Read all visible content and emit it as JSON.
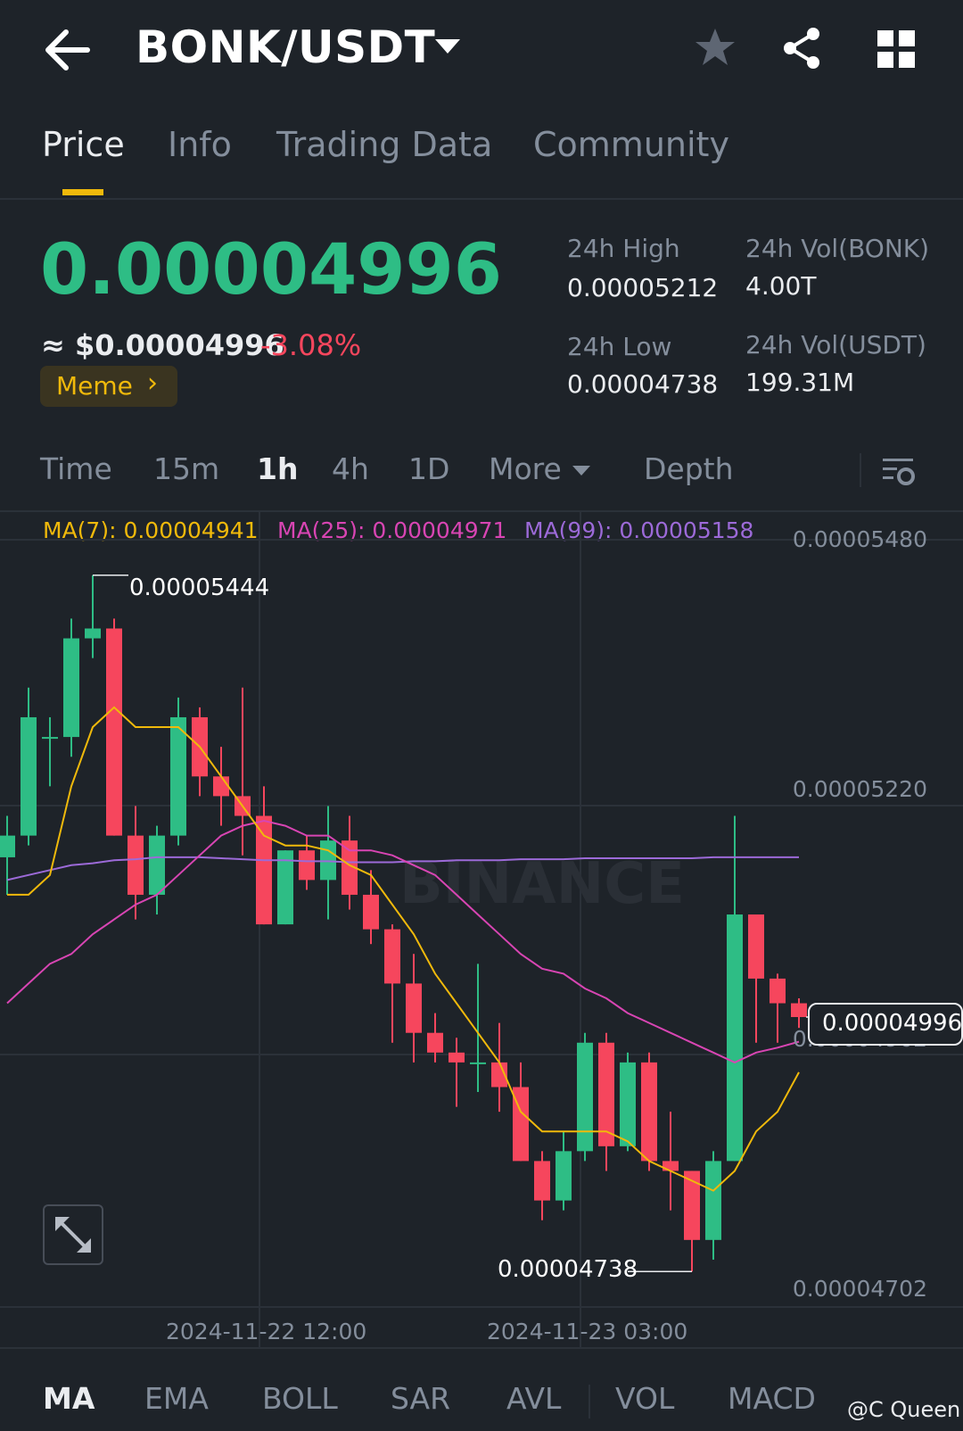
{
  "header": {
    "pair": "BONK/USDT",
    "icons": [
      "back-arrow-icon",
      "caret-down-icon",
      "star-icon",
      "share-icon",
      "grid-icon"
    ]
  },
  "tabs": [
    {
      "label": "Price",
      "active": true
    },
    {
      "label": "Info"
    },
    {
      "label": "Trading Data"
    },
    {
      "label": "Community"
    }
  ],
  "price": {
    "last": "0.00004996",
    "usd": "≈ $0.00004996",
    "change": "-3.08%",
    "tag": "Meme",
    "colors": {
      "up": "#2ebd85",
      "down": "#f6465d",
      "accent": "#f0b90b"
    }
  },
  "stats": {
    "high_label": "24h High",
    "high": "0.00005212",
    "low_label": "24h Low",
    "low": "0.00004738",
    "vol_base_label": "24h Vol(BONK)",
    "vol_base": "4.00T",
    "vol_quote_label": "24h Vol(USDT)",
    "vol_quote": "199.31M"
  },
  "intervals": {
    "time": "Time",
    "m15": "15m",
    "h1": "1h",
    "h4": "4h",
    "d1": "1D",
    "more": "More",
    "depth": "Depth",
    "active": "1h"
  },
  "ma_legend": {
    "ma7": "MA(7): 0.00004941",
    "ma25": "MA(25): 0.00004971",
    "ma99": "MA(99): 0.00005158"
  },
  "chart_data": {
    "type": "candlestick",
    "interval": "1h",
    "ylim": [
      4.702e-05,
      5.48e-05
    ],
    "y_ticks": [
      "0.00005480",
      "0.00005220",
      "0.00004962",
      "0.00004702"
    ],
    "x_ticks": [
      "2024-11-22 12:00",
      "2024-11-23 03:00"
    ],
    "high_annotation": "0.00005444",
    "low_annotation": "0.00004738",
    "last_price_label": "0.00004996",
    "watermark": "BINANCE",
    "candles": [
      {
        "o": 5.158e-05,
        "h": 5.2e-05,
        "l": 5.12e-05,
        "c": 5.18e-05
      },
      {
        "o": 5.18e-05,
        "h": 5.33e-05,
        "l": 5.17e-05,
        "c": 5.3e-05
      },
      {
        "o": 5.28e-05,
        "h": 5.3e-05,
        "l": 5.23e-05,
        "c": 5.28e-05
      },
      {
        "o": 5.28e-05,
        "h": 5.4e-05,
        "l": 5.26e-05,
        "c": 5.38e-05
      },
      {
        "o": 5.38e-05,
        "h": 5.444e-05,
        "l": 5.36e-05,
        "c": 5.39e-05
      },
      {
        "o": 5.39e-05,
        "h": 5.4e-05,
        "l": 5.18e-05,
        "c": 5.18e-05
      },
      {
        "o": 5.18e-05,
        "h": 5.21e-05,
        "l": 5.095e-05,
        "c": 5.12e-05
      },
      {
        "o": 5.12e-05,
        "h": 5.19e-05,
        "l": 5.1e-05,
        "c": 5.18e-05
      },
      {
        "o": 5.18e-05,
        "h": 5.32e-05,
        "l": 5.17e-05,
        "c": 5.3e-05
      },
      {
        "o": 5.3e-05,
        "h": 5.31e-05,
        "l": 5.22e-05,
        "c": 5.24e-05
      },
      {
        "o": 5.24e-05,
        "h": 5.27e-05,
        "l": 5.19e-05,
        "c": 5.22e-05
      },
      {
        "o": 5.22e-05,
        "h": 5.33e-05,
        "l": 5.16e-05,
        "c": 5.2e-05
      },
      {
        "o": 5.2e-05,
        "h": 5.23e-05,
        "l": 5.09e-05,
        "c": 5.09e-05
      },
      {
        "o": 5.09e-05,
        "h": 5.165e-05,
        "l": 5.09e-05,
        "c": 5.165e-05
      },
      {
        "o": 5.165e-05,
        "h": 5.18e-05,
        "l": 5.125e-05,
        "c": 5.135e-05
      },
      {
        "o": 5.135e-05,
        "h": 5.21e-05,
        "l": 5.095e-05,
        "c": 5.175e-05
      },
      {
        "o": 5.175e-05,
        "h": 5.2e-05,
        "l": 5.105e-05,
        "c": 5.12e-05
      },
      {
        "o": 5.12e-05,
        "h": 5.145e-05,
        "l": 5.07e-05,
        "c": 5.085e-05
      },
      {
        "o": 5.085e-05,
        "h": 5.09e-05,
        "l": 4.97e-05,
        "c": 5.03e-05
      },
      {
        "o": 5.03e-05,
        "h": 5.06e-05,
        "l": 4.95e-05,
        "c": 4.98e-05
      },
      {
        "o": 4.98e-05,
        "h": 5e-05,
        "l": 4.95e-05,
        "c": 4.96e-05
      },
      {
        "o": 4.96e-05,
        "h": 4.975e-05,
        "l": 4.905e-05,
        "c": 4.95e-05
      },
      {
        "o": 4.95e-05,
        "h": 5.05e-05,
        "l": 4.92e-05,
        "c": 4.95e-05
      },
      {
        "o": 4.95e-05,
        "h": 4.99e-05,
        "l": 4.9e-05,
        "c": 4.925e-05
      },
      {
        "o": 4.925e-05,
        "h": 4.95e-05,
        "l": 4.85e-05,
        "c": 4.85e-05
      },
      {
        "o": 4.85e-05,
        "h": 4.86e-05,
        "l": 4.79e-05,
        "c": 4.81e-05
      },
      {
        "o": 4.81e-05,
        "h": 4.88e-05,
        "l": 4.8e-05,
        "c": 4.86e-05
      },
      {
        "o": 4.86e-05,
        "h": 4.98e-05,
        "l": 4.85e-05,
        "c": 4.97e-05
      },
      {
        "o": 4.97e-05,
        "h": 4.98e-05,
        "l": 4.84e-05,
        "c": 4.865e-05
      },
      {
        "o": 4.865e-05,
        "h": 4.96e-05,
        "l": 4.86e-05,
        "c": 4.95e-05
      },
      {
        "o": 4.95e-05,
        "h": 4.96e-05,
        "l": 4.84e-05,
        "c": 4.85e-05
      },
      {
        "o": 4.85e-05,
        "h": 4.9e-05,
        "l": 4.8e-05,
        "c": 4.84e-05
      },
      {
        "o": 4.84e-05,
        "h": 4.84e-05,
        "l": 4.738e-05,
        "c": 4.77e-05
      },
      {
        "o": 4.77e-05,
        "h": 4.86e-05,
        "l": 4.75e-05,
        "c": 4.85e-05
      },
      {
        "o": 4.85e-05,
        "h": 5.2e-05,
        "l": 4.85e-05,
        "c": 5.1e-05
      },
      {
        "o": 5.1e-05,
        "h": 5.08e-05,
        "l": 4.97e-05,
        "c": 5.035e-05
      },
      {
        "o": 5.035e-05,
        "h": 5.04e-05,
        "l": 4.97e-05,
        "c": 5.01e-05
      },
      {
        "o": 5.01e-05,
        "h": 5.015e-05,
        "l": 4.985e-05,
        "c": 4.996e-05
      }
    ],
    "ma7": [
      5.12e-05,
      5.12e-05,
      5.14e-05,
      5.23e-05,
      5.29e-05,
      5.31e-05,
      5.29e-05,
      5.29e-05,
      5.29e-05,
      5.27e-05,
      5.24e-05,
      5.21e-05,
      5.18e-05,
      5.17e-05,
      5.17e-05,
      5.165e-05,
      5.15e-05,
      5.14e-05,
      5.11e-05,
      5.08e-05,
      5.04e-05,
      5.01e-05,
      4.98e-05,
      4.95e-05,
      4.9e-05,
      4.88e-05,
      4.88e-05,
      4.88e-05,
      4.88e-05,
      4.87e-05,
      4.85e-05,
      4.84e-05,
      4.83e-05,
      4.82e-05,
      4.84e-05,
      4.88e-05,
      4.9e-05,
      4.94e-05
    ],
    "ma25": [
      5.01e-05,
      5.03e-05,
      5.05e-05,
      5.06e-05,
      5.08e-05,
      5.095e-05,
      5.11e-05,
      5.12e-05,
      5.14e-05,
      5.16e-05,
      5.18e-05,
      5.19e-05,
      5.195e-05,
      5.19e-05,
      5.18e-05,
      5.18e-05,
      5.165e-05,
      5.165e-05,
      5.16e-05,
      5.15e-05,
      5.14e-05,
      5.12e-05,
      5.1e-05,
      5.08e-05,
      5.06e-05,
      5.045e-05,
      5.04e-05,
      5.025e-05,
      5.015e-05,
      5e-05,
      4.99e-05,
      4.98e-05,
      4.97e-05,
      4.96e-05,
      4.95e-05,
      4.96e-05,
      4.965e-05,
      4.971e-05
    ],
    "ma99": [
      5.135e-05,
      5.14e-05,
      5.145e-05,
      5.15e-05,
      5.152e-05,
      5.155e-05,
      5.156e-05,
      5.158e-05,
      5.158e-05,
      5.158e-05,
      5.157e-05,
      5.156e-05,
      5.155e-05,
      5.155e-05,
      5.154e-05,
      5.154e-05,
      5.153e-05,
      5.153e-05,
      5.153e-05,
      5.154e-05,
      5.154e-05,
      5.155e-05,
      5.155e-05,
      5.155e-05,
      5.156e-05,
      5.156e-05,
      5.156e-05,
      5.157e-05,
      5.157e-05,
      5.157e-05,
      5.157e-05,
      5.157e-05,
      5.157e-05,
      5.158e-05,
      5.158e-05,
      5.158e-05,
      5.158e-05,
      5.158e-05
    ]
  },
  "indicators": [
    "MA",
    "EMA",
    "BOLL",
    "SAR",
    "AVL",
    "VOL",
    "MACD"
  ],
  "watermark_user": "@C Queen"
}
